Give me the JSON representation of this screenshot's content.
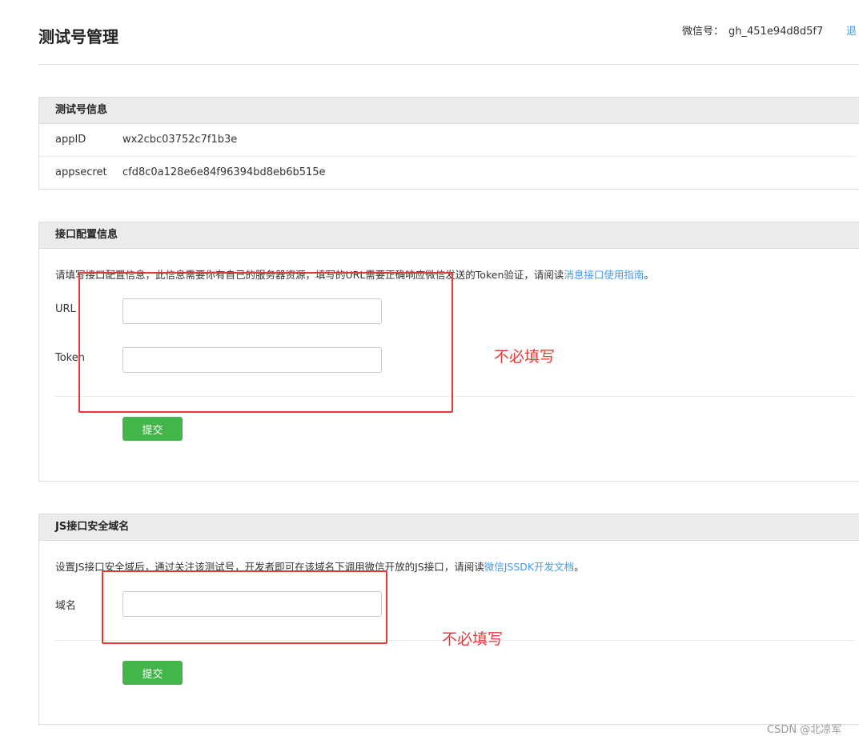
{
  "header": {
    "title": "测试号管理",
    "wechat_label": "微信号：",
    "wechat_id": "gh_451e94d8d5f7",
    "logout_label": "退"
  },
  "test_info": {
    "section_title": "测试号信息",
    "rows": [
      {
        "key": "appID",
        "value": "wx2cbc03752c7f1b3e"
      },
      {
        "key": "appsecret",
        "value": "cfd8c0a128e6e84f96394bd8eb6b515e"
      }
    ]
  },
  "interface_config": {
    "section_title": "接口配置信息",
    "desc_text": "请填写接口配置信息，此信息需要你有自己的服务器资源，填写的URL需要正确响应微信发送的Token验证，请阅读",
    "desc_link": "消息接口使用指南",
    "desc_end": "。",
    "url_label": "URL",
    "url_value": "",
    "token_label": "Token",
    "token_value": "",
    "submit_label": "提交"
  },
  "js_domain": {
    "section_title": "JS接口安全域名",
    "desc_text": "设置JS接口安全域后，通过关注该测试号，开发者即可在该域名下调用微信开放的JS接口，请阅读",
    "desc_link": "微信JSSDK开发文档",
    "desc_end": "。",
    "domain_label": "域名",
    "domain_value": "",
    "submit_label": "提交"
  },
  "annotations": {
    "note_1": "不必填写",
    "note_2": "不必填写",
    "color": "#e53935"
  },
  "watermark": "CSDN @北凉军",
  "colors": {
    "accent_green": "#44b549",
    "link_blue": "#459ae9",
    "section_header_bg": "#ebebeb"
  }
}
